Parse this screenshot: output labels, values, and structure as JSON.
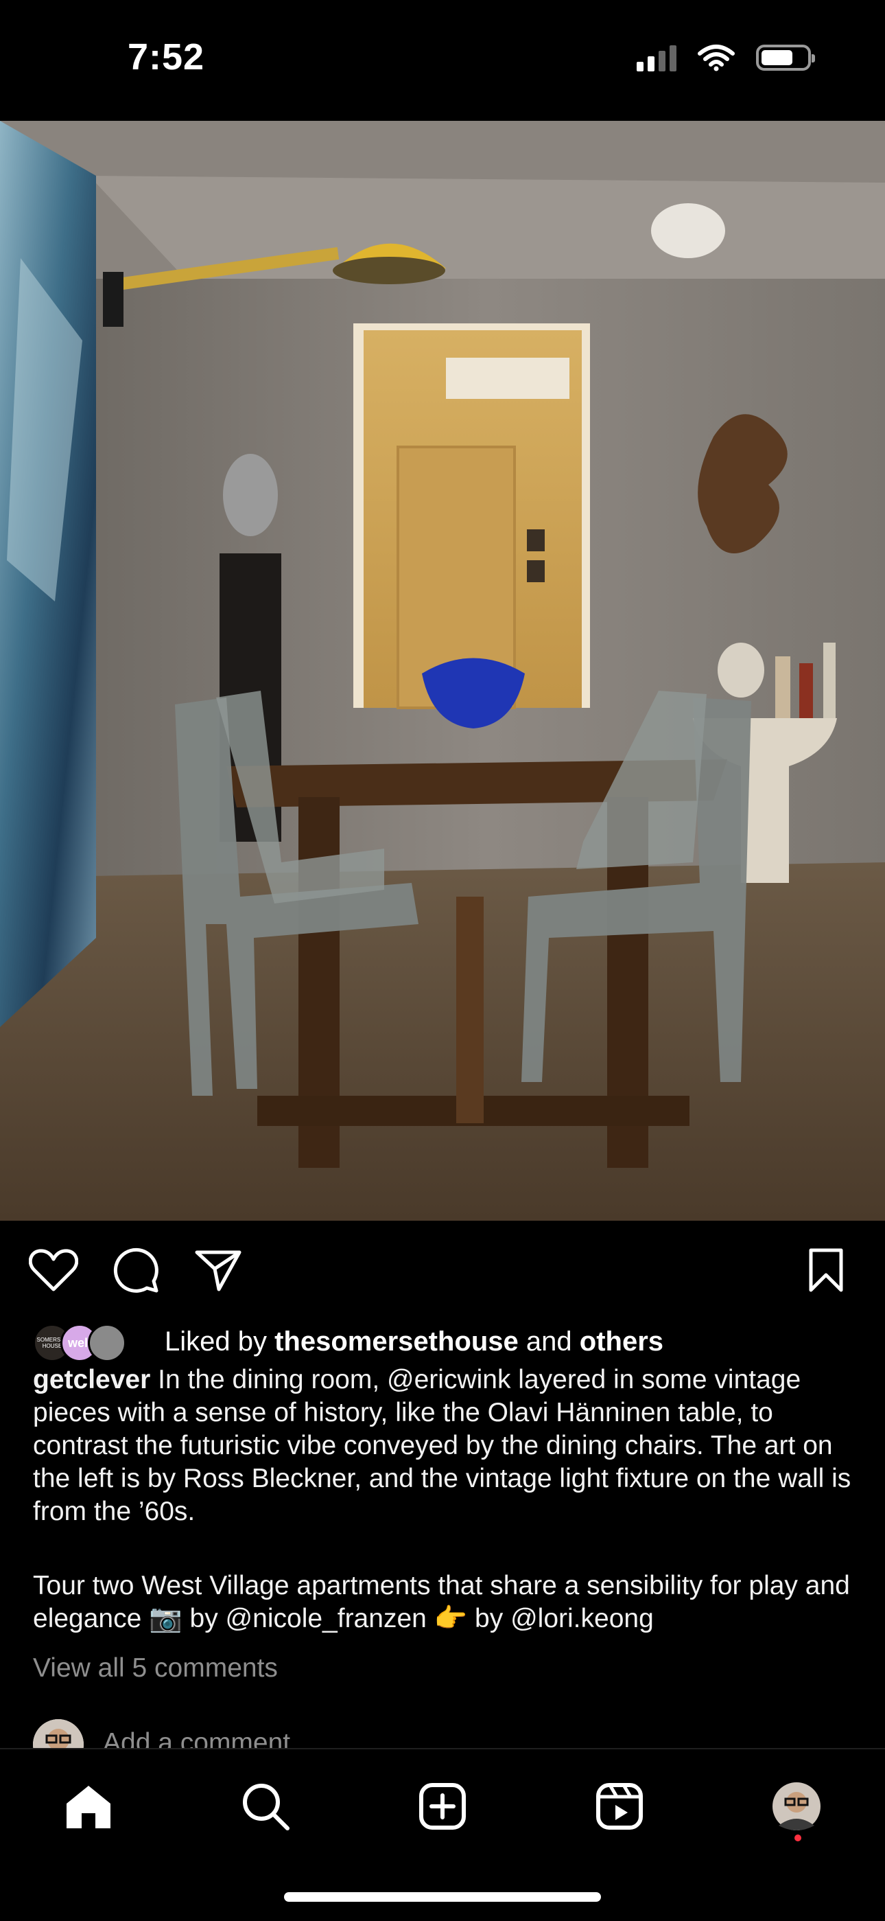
{
  "status_bar": {
    "time": "7:52",
    "signal_icon": "cellular-signal-icon",
    "wifi_icon": "wifi-icon",
    "battery_icon": "battery-icon",
    "battery_level": 0.7
  },
  "post": {
    "image_alt": "Dining room with wooden table, metal chairs and yellow doorway",
    "actions": {
      "like_icon": "heart-icon",
      "comment_icon": "comment-icon",
      "share_icon": "send-icon",
      "save_icon": "bookmark-icon"
    },
    "likes": {
      "prefix": "Liked by",
      "user": "thesomersethouse",
      "conjunction": "and",
      "others": "others",
      "avatar_labels": [
        "SOMERSET HOUSE",
        "well"
      ]
    },
    "caption": {
      "username": "getclever",
      "paragraph1": "In the dining room, @ericwink layered in some vintage pieces with a sense of history, like the Olavi Hänninen table, to contrast the futuristic vibe conveyed by the dining chairs. The art on the left is by Ross Bleckner, and the vintage light fixture on the wall is from the ’60s.",
      "paragraph2": "Tour two West Village apartments that share a sensibility for play and elegance 📷 by @nicole_franzen 👉 by @lori.keong"
    },
    "view_comments": "View all 5 comments",
    "add_comment_placeholder": "Add a comment…"
  },
  "bottom_nav": {
    "items": [
      {
        "name": "home",
        "icon": "home-icon"
      },
      {
        "name": "search",
        "icon": "search-icon"
      },
      {
        "name": "create",
        "icon": "plus-square-icon"
      },
      {
        "name": "reels",
        "icon": "reels-icon"
      },
      {
        "name": "profile",
        "icon": "profile-avatar"
      }
    ]
  },
  "colors": {
    "background": "#000000",
    "text": "#ffffff",
    "muted": "#8e8e8e",
    "notification": "#ff3040"
  }
}
